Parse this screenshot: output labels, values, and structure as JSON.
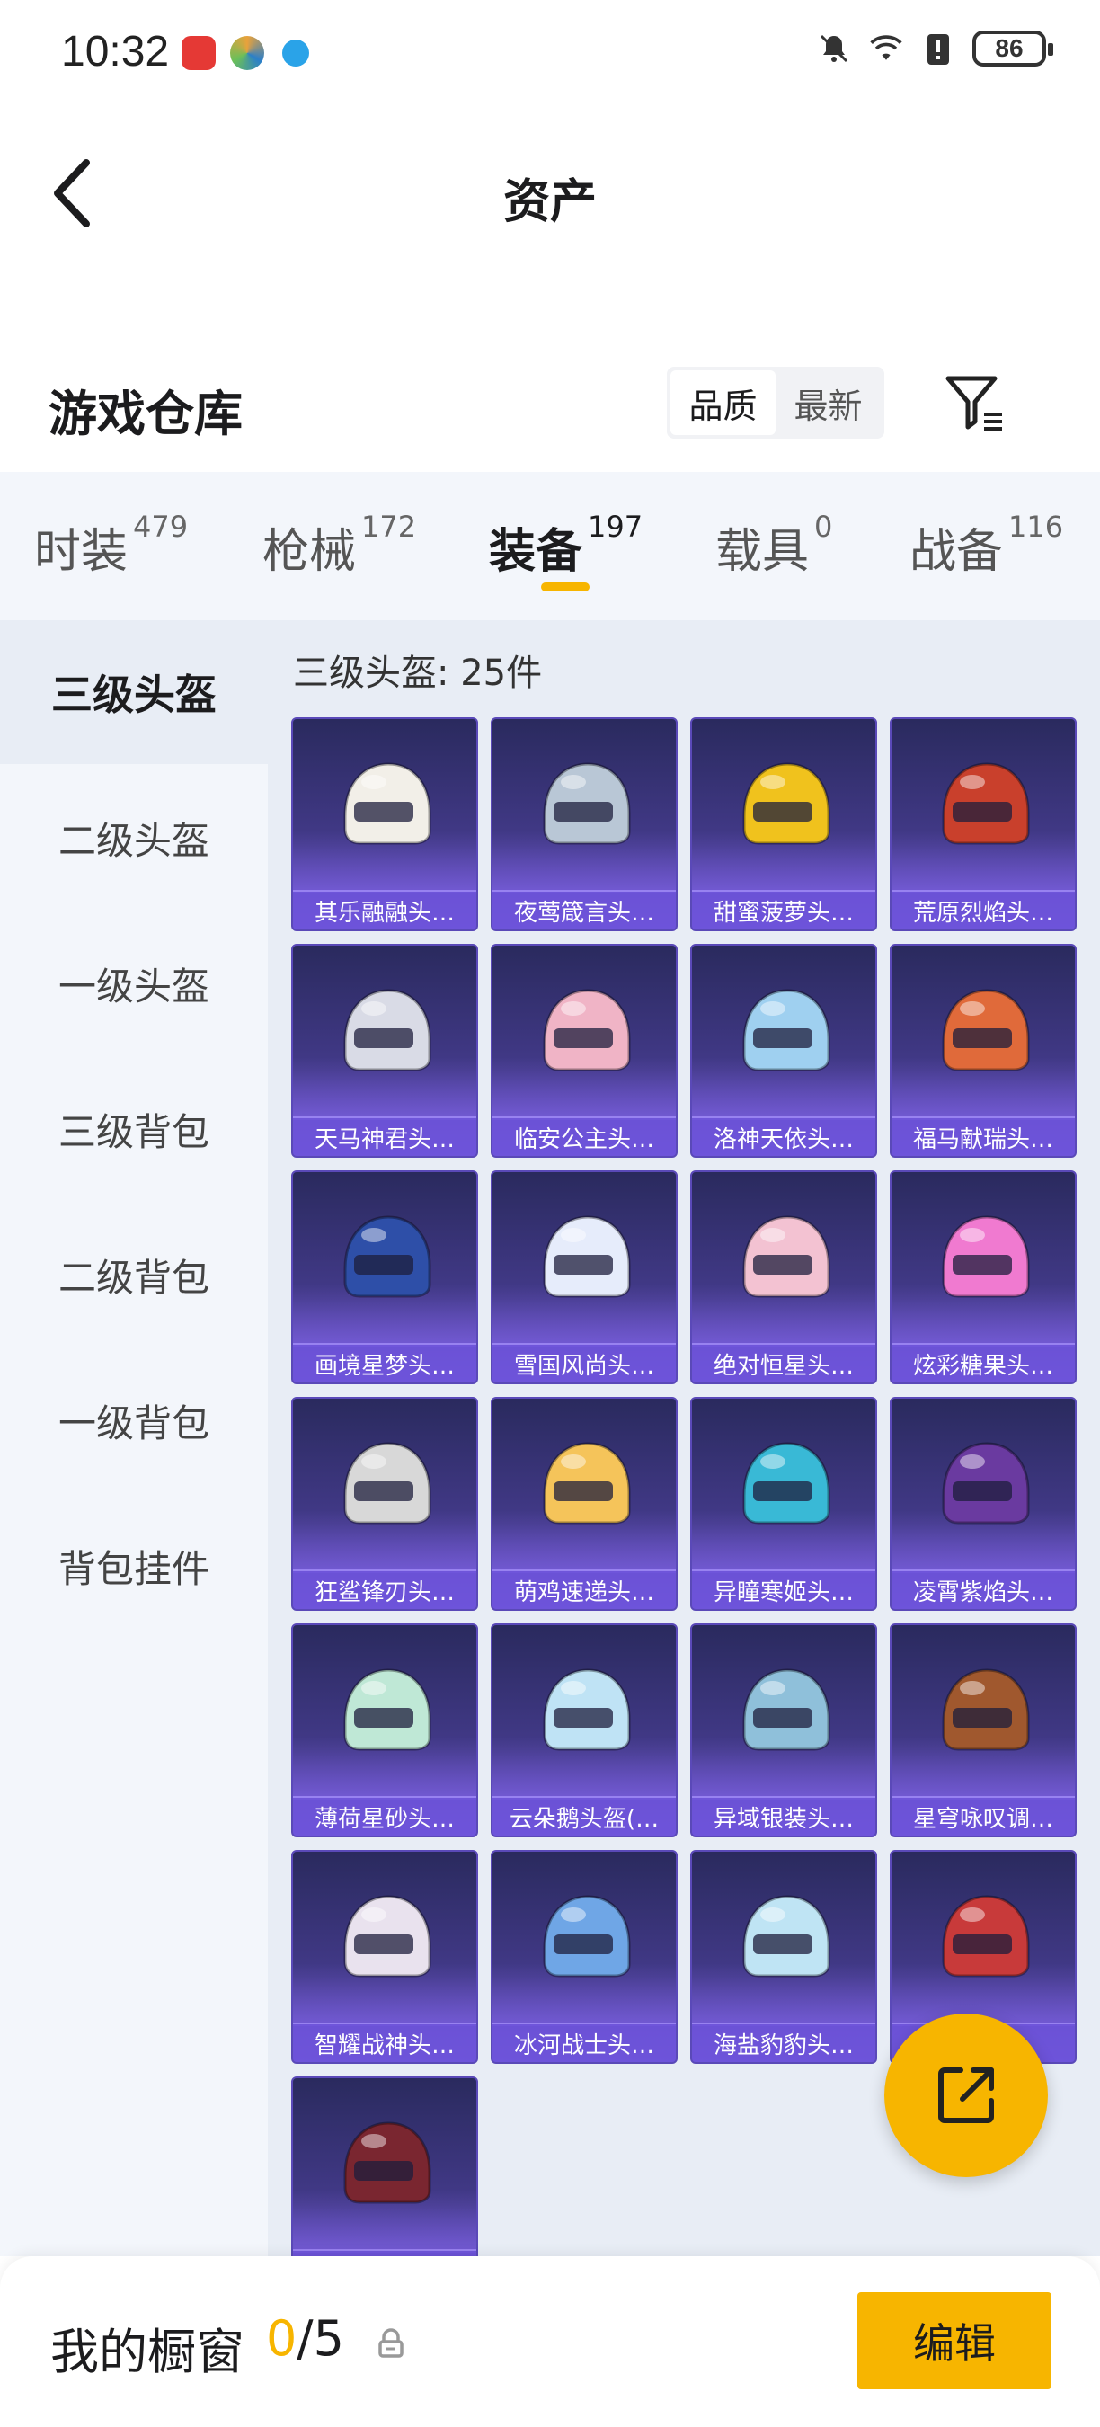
{
  "status_bar": {
    "time": "10:32",
    "battery": "86",
    "icons": [
      "mute-icon",
      "wifi-icon",
      "alert-icon",
      "battery-icon"
    ]
  },
  "header": {
    "title": "资产",
    "back_icon": "back-chevron-icon"
  },
  "warehouse": {
    "title": "游戏仓库",
    "sort_options": [
      "品质",
      "最新"
    ],
    "sort_selected": "品质",
    "filter_icon": "filter-icon"
  },
  "categories": [
    {
      "label": "时装",
      "count": "479"
    },
    {
      "label": "枪械",
      "count": "172"
    },
    {
      "label": "装备",
      "count": "197"
    },
    {
      "label": "载具",
      "count": "0"
    },
    {
      "label": "战备",
      "count": "116"
    }
  ],
  "active_category": "装备",
  "side_menu": [
    "三级头盔",
    "二级头盔",
    "一级头盔",
    "三级背包",
    "二级背包",
    "一级背包",
    "背包挂件"
  ],
  "active_side": "三级头盔",
  "grid": {
    "heading": "三级头盔: 25件",
    "items": [
      {
        "name": "其乐融融头…",
        "color": "#f2efe8"
      },
      {
        "name": "夜莺箴言头…",
        "color": "#b9c7d6"
      },
      {
        "name": "甜蜜菠萝头…",
        "color": "#f0c21d"
      },
      {
        "name": "荒原烈焰头…",
        "color": "#c9402c"
      },
      {
        "name": "天马神君头…",
        "color": "#d9dbe6"
      },
      {
        "name": "临安公主头…",
        "color": "#f0b4c6"
      },
      {
        "name": "洛神天依头…",
        "color": "#9fd0f0"
      },
      {
        "name": "福马献瑞头…",
        "color": "#e06a3a"
      },
      {
        "name": "画境星梦头…",
        "color": "#2e4fa8"
      },
      {
        "name": "雪国风尚头…",
        "color": "#e6ecfb"
      },
      {
        "name": "绝对恒星头…",
        "color": "#f3c2d2"
      },
      {
        "name": "炫彩糖果头…",
        "color": "#f07ad0"
      },
      {
        "name": "狂鲨锋刃头…",
        "color": "#d8d8d8"
      },
      {
        "name": "萌鸡速递头…",
        "color": "#f5c45a"
      },
      {
        "name": "异瞳寒姬头…",
        "color": "#39b9d6"
      },
      {
        "name": "凌霄紫焰头…",
        "color": "#6a3aa0"
      },
      {
        "name": "薄荷星砂头…",
        "color": "#bfe8d6"
      },
      {
        "name": "云朵鹅头盔(…",
        "color": "#bfe3f5"
      },
      {
        "name": "异域银装头…",
        "color": "#8fc0da"
      },
      {
        "name": "星穹咏叹调…",
        "color": "#a0582e"
      },
      {
        "name": "智耀战神头…",
        "color": "#e9e2ee"
      },
      {
        "name": "冰河战士头…",
        "color": "#6fa6e6"
      },
      {
        "name": "海盐豹豹头…",
        "color": "#bfe4f4"
      },
      {
        "name": "…",
        "color": "#c83a3a"
      },
      {
        "name": "",
        "color": "#7a2630"
      }
    ]
  },
  "fab": {
    "icon": "share-icon"
  },
  "showcase": {
    "label": "我的橱窗",
    "current": "0",
    "separator": "/",
    "total": "5",
    "lock_icon": "lock-icon",
    "edit_label": "编辑"
  },
  "colors": {
    "accent": "#f7b500",
    "card_bg": "#433a8a"
  }
}
